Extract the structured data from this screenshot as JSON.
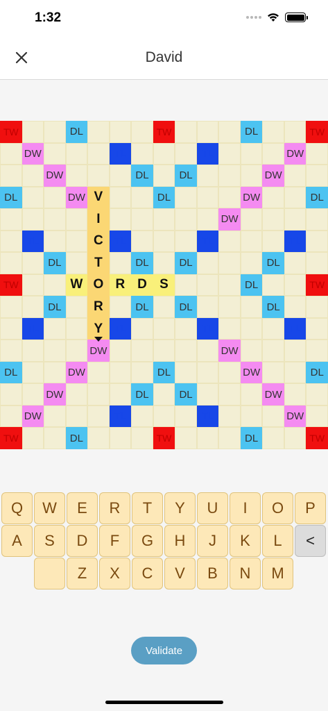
{
  "status": {
    "time": "1:32"
  },
  "nav": {
    "title": "David"
  },
  "board": {
    "rows": [
      [
        "TW",
        "",
        "",
        "DL",
        "",
        "",
        "",
        "TW",
        "",
        "",
        "",
        "DL",
        "",
        "",
        "TW"
      ],
      [
        "",
        "DW",
        "",
        "",
        "",
        "TL",
        "",
        "",
        "",
        "TL",
        "",
        "",
        "",
        "DW",
        ""
      ],
      [
        "",
        "",
        "DW",
        "",
        "",
        "",
        "DL",
        "",
        "DL",
        "",
        "",
        "",
        "DW",
        "",
        ""
      ],
      [
        "DL",
        "",
        "",
        "DW",
        "V",
        "",
        "",
        "DL",
        "",
        "",
        "",
        "DW",
        "",
        "",
        "DL"
      ],
      [
        "",
        "",
        "",
        "",
        "I",
        "",
        "",
        "",
        "",
        "",
        "DW",
        "",
        "",
        "",
        ""
      ],
      [
        "",
        "TL",
        "",
        "",
        "C",
        "TL",
        "",
        "",
        "",
        "TL",
        "",
        "",
        "",
        "TL",
        ""
      ],
      [
        "",
        "",
        "DL",
        "",
        "T",
        "",
        "DL",
        "",
        "DL",
        "",
        "",
        "",
        "DL",
        "",
        ""
      ],
      [
        "TW",
        "",
        "",
        "W",
        "O",
        "R",
        "D",
        "S",
        "",
        "",
        "",
        "DL",
        "",
        "",
        "TW"
      ],
      [
        "",
        "",
        "DL",
        "",
        "R",
        "",
        "DL",
        "",
        "DL",
        "",
        "",
        "",
        "DL",
        "",
        ""
      ],
      [
        "",
        "TL",
        "",
        "",
        "Y",
        "TL",
        "",
        "",
        "",
        "TL",
        "",
        "",
        "",
        "TL",
        ""
      ],
      [
        "",
        "",
        "",
        "",
        "DW",
        "",
        "",
        "",
        "",
        "",
        "DW",
        "",
        "",
        "",
        ""
      ],
      [
        "DL",
        "",
        "",
        "DW",
        "",
        "",
        "",
        "DL",
        "",
        "",
        "",
        "DW",
        "",
        "",
        "DL"
      ],
      [
        "",
        "",
        "DW",
        "",
        "",
        "",
        "DL",
        "",
        "DL",
        "",
        "",
        "",
        "DW",
        "",
        ""
      ],
      [
        "",
        "DW",
        "",
        "",
        "",
        "TL",
        "",
        "",
        "",
        "TL",
        "",
        "",
        "",
        "DW",
        ""
      ],
      [
        "TW",
        "",
        "",
        "DL",
        "",
        "",
        "",
        "TW",
        "",
        "",
        "",
        "DL",
        "",
        "",
        "TW"
      ]
    ]
  },
  "keyboard": {
    "row1": [
      "Q",
      "W",
      "E",
      "R",
      "T",
      "Y",
      "U",
      "I",
      "O",
      "P"
    ],
    "row2": [
      "A",
      "S",
      "D",
      "F",
      "G",
      "H",
      "J",
      "K",
      "L"
    ],
    "row2_backspace": "<",
    "row3_blank": "",
    "row3": [
      "Z",
      "X",
      "C",
      "V",
      "B",
      "N",
      "M"
    ]
  },
  "validate_label": "Validate",
  "colors": {
    "tw": "#f00f0f",
    "dl": "#4cc3f1",
    "dw": "#f48bf1",
    "tl": "#1747e8",
    "tile_horizontal": "#f9f07a",
    "tile_vertical": "#fbd774",
    "key": "#fde8b8",
    "validate": "#5a9fc4"
  }
}
